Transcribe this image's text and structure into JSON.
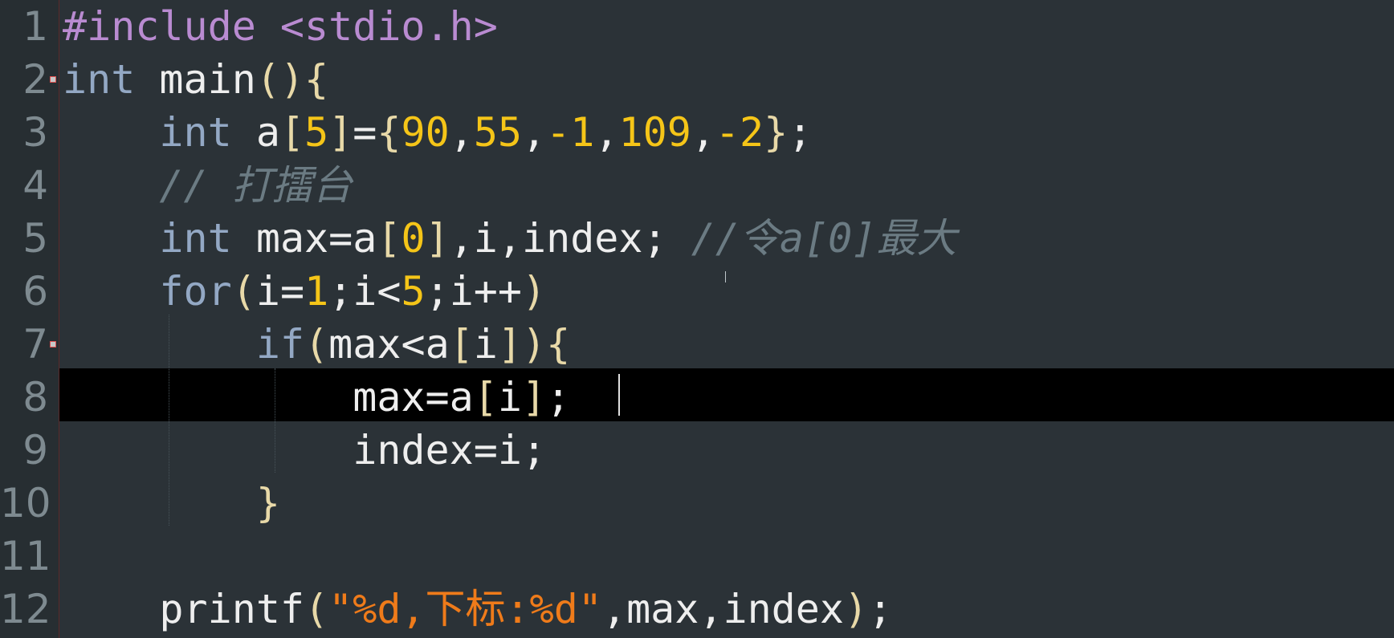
{
  "editor": {
    "language": "C",
    "current_line": 8,
    "line_numbers": [
      "1",
      "2",
      "3",
      "4",
      "5",
      "6",
      "7",
      "8",
      "9",
      "10",
      "11",
      "12"
    ],
    "fold_marker_lines": [
      2,
      7
    ],
    "lines": [
      {
        "segments": [
          {
            "t": "pp",
            "v": "#include <stdio.h>"
          }
        ]
      },
      {
        "segments": [
          {
            "t": "kw",
            "v": "int"
          },
          {
            "t": "",
            "v": " main"
          },
          {
            "t": "brk",
            "v": "()"
          },
          {
            "t": "brk",
            "v": "{"
          }
        ]
      },
      {
        "segments": [
          {
            "t": "",
            "v": "    "
          },
          {
            "t": "kw",
            "v": "int"
          },
          {
            "t": "",
            "v": " a"
          },
          {
            "t": "brk",
            "v": "["
          },
          {
            "t": "num",
            "v": "5"
          },
          {
            "t": "brk",
            "v": "]"
          },
          {
            "t": "",
            "v": "="
          },
          {
            "t": "brk",
            "v": "{"
          },
          {
            "t": "num",
            "v": "90"
          },
          {
            "t": "",
            "v": ","
          },
          {
            "t": "num",
            "v": "55"
          },
          {
            "t": "",
            "v": ","
          },
          {
            "t": "num",
            "v": "-1"
          },
          {
            "t": "",
            "v": ","
          },
          {
            "t": "num",
            "v": "109"
          },
          {
            "t": "",
            "v": ","
          },
          {
            "t": "num",
            "v": "-2"
          },
          {
            "t": "brk",
            "v": "}"
          },
          {
            "t": "",
            "v": ";"
          }
        ]
      },
      {
        "segments": [
          {
            "t": "",
            "v": "    "
          },
          {
            "t": "cmt",
            "v": "// 打擂台"
          }
        ]
      },
      {
        "segments": [
          {
            "t": "",
            "v": "    "
          },
          {
            "t": "kw",
            "v": "int"
          },
          {
            "t": "",
            "v": " max=a"
          },
          {
            "t": "brk",
            "v": "["
          },
          {
            "t": "num",
            "v": "0"
          },
          {
            "t": "brk",
            "v": "]"
          },
          {
            "t": "",
            "v": ",i,index; "
          },
          {
            "t": "cmt",
            "v": "//令a[0]最大"
          }
        ]
      },
      {
        "segments": [
          {
            "t": "",
            "v": "    "
          },
          {
            "t": "kw",
            "v": "for"
          },
          {
            "t": "brk",
            "v": "("
          },
          {
            "t": "",
            "v": "i="
          },
          {
            "t": "num",
            "v": "1"
          },
          {
            "t": "",
            "v": ";i<"
          },
          {
            "t": "num",
            "v": "5"
          },
          {
            "t": "",
            "v": ";i++"
          },
          {
            "t": "brk",
            "v": ")"
          }
        ]
      },
      {
        "segments": [
          {
            "t": "",
            "v": "        "
          },
          {
            "t": "kw",
            "v": "if"
          },
          {
            "t": "brk",
            "v": "("
          },
          {
            "t": "",
            "v": "max<a"
          },
          {
            "t": "brk",
            "v": "["
          },
          {
            "t": "",
            "v": "i"
          },
          {
            "t": "brk",
            "v": "]"
          },
          {
            "t": "brk",
            "v": ")"
          },
          {
            "t": "brk",
            "v": "{"
          }
        ]
      },
      {
        "segments": [
          {
            "t": "",
            "v": "            max=a"
          },
          {
            "t": "brk",
            "v": "["
          },
          {
            "t": "",
            "v": "i"
          },
          {
            "t": "brk",
            "v": "]"
          },
          {
            "t": "",
            "v": ";"
          }
        ]
      },
      {
        "segments": [
          {
            "t": "",
            "v": "            index=i;"
          }
        ]
      },
      {
        "segments": [
          {
            "t": "",
            "v": "        "
          },
          {
            "t": "brk",
            "v": "}"
          }
        ]
      },
      {
        "segments": [
          {
            "t": "",
            "v": ""
          }
        ]
      },
      {
        "segments": [
          {
            "t": "",
            "v": "    printf"
          },
          {
            "t": "brk",
            "v": "("
          },
          {
            "t": "str",
            "v": "\"%d,下标:%d\""
          },
          {
            "t": "",
            "v": ",max,index"
          },
          {
            "t": "brk",
            "v": ")"
          },
          {
            "t": "",
            "v": ";"
          }
        ]
      }
    ]
  },
  "colors": {
    "background": "#2b3237",
    "gutter": "#272e32",
    "current_line_highlight": "#000000",
    "keyword": "#93a8c4",
    "preprocessor": "#b98bd1",
    "number": "#f5c518",
    "string": "#ef7b1a",
    "comment": "#6b7b83",
    "bracket": "#e8d9a8",
    "identifier": "#eeeeee"
  }
}
